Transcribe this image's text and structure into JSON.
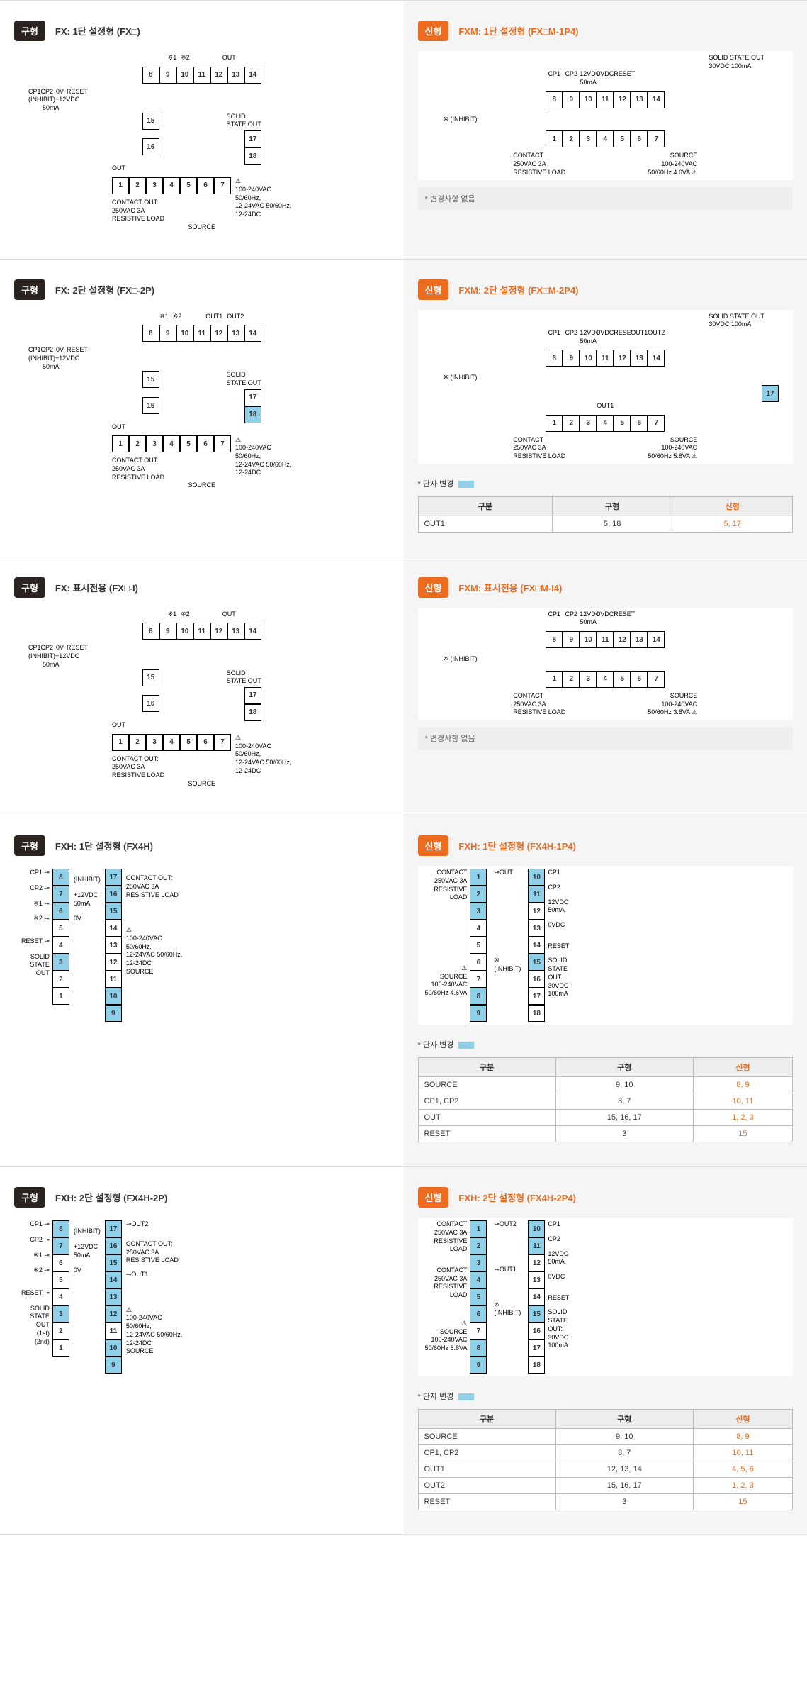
{
  "tags": {
    "old": "구형",
    "new": "신형"
  },
  "notes": {
    "terminal": "* 단자 변경",
    "nochange": "* 변경사항 없음"
  },
  "changeHeaders": {
    "c1": "구분",
    "c2": "구형",
    "c3": "신형"
  },
  "power": {
    "a": "100-240VAC",
    "b": "50/60Hz,",
    "c": "12-24VAC 50/60Hz,",
    "d": "12-24DC",
    "src": "SOURCE"
  },
  "contact": {
    "a": "CONTACT OUT:",
    "b": "250VAC 3A",
    "c": "RESISTIVE LOAD"
  },
  "sso": {
    "a": "SOLID",
    "b": "STATE OUT"
  },
  "ssoTop": "SOLID STATE OUT\n30VDC 100mA",
  "lbl": {
    "cp1": "CP1",
    "cp2": "CP2",
    "v12": "12VDC\n50mA",
    "ovdc": "0VDC",
    "reset": "RESET",
    "out1": "OUT1",
    "out2": "OUT2",
    "inhibit": "※ (INHIBIT)",
    "cplbl": "CP1CP2",
    "ov": "0V",
    "out": "OUT"
  },
  "srcNew": {
    "a": "SOURCE",
    "b": "100-240VAC",
    "c": "50/60Hz 4.6VA",
    "c2": "50/60Hz 5.8VA",
    "c3": "50/60Hz 3.8VA"
  },
  "rows": [
    {
      "oldTitle": "FX: 1단 설정형 (FX□)",
      "newTitle": "FXM: 1단 설정형 (FX□M-1P4)",
      "oldType": "fx14",
      "newType": "fxm-h",
      "noteOnly": true,
      "sv": "c"
    },
    {
      "oldTitle": "FX: 2단 설정형 (FX□-2P)",
      "newTitle": "FXM: 2단 설정형 (FX□M-2P4)",
      "oldType": "fx14b",
      "newType": "fxm-h2",
      "sv": "c2",
      "change": [
        [
          "OUT1",
          "5, 18",
          "5, 17"
        ]
      ]
    },
    {
      "oldTitle": "FX: 표시전용 (FX□-I)",
      "newTitle": "FXM: 표시전용 (FX□M-I4)",
      "oldType": "fx14c",
      "newType": "fxm-i",
      "noteOnly": true,
      "sv": "c3"
    },
    {
      "oldTitle": "FXH: 1단 설정형 (FX4H)",
      "newTitle": "FXH: 1단 설정형 (FX4H-1P4)",
      "oldType": "fxh",
      "newType": "fxh-n",
      "change": [
        [
          "SOURCE",
          "9, 10",
          "8, 9"
        ],
        [
          "CP1, CP2",
          "8, 7",
          "10, 11"
        ],
        [
          "OUT",
          "15, 16, 17",
          "1, 2, 3"
        ],
        [
          "RESET",
          "3",
          "15"
        ]
      ]
    },
    {
      "oldTitle": "FXH: 2단 설정형 (FX4H-2P)",
      "newTitle": "FXH: 2단 설정형 (FX4H-2P4)",
      "oldType": "fxh2",
      "newType": "fxh-n2",
      "change": [
        [
          "SOURCE",
          "9, 10",
          "8, 9"
        ],
        [
          "CP1, CP2",
          "8, 7",
          "10, 11"
        ],
        [
          "OUT1",
          "12, 13, 14",
          "4, 5, 6"
        ],
        [
          "OUT2",
          "15, 16, 17",
          "1, 2, 3"
        ],
        [
          "RESET",
          "3",
          "15"
        ]
      ]
    }
  ]
}
